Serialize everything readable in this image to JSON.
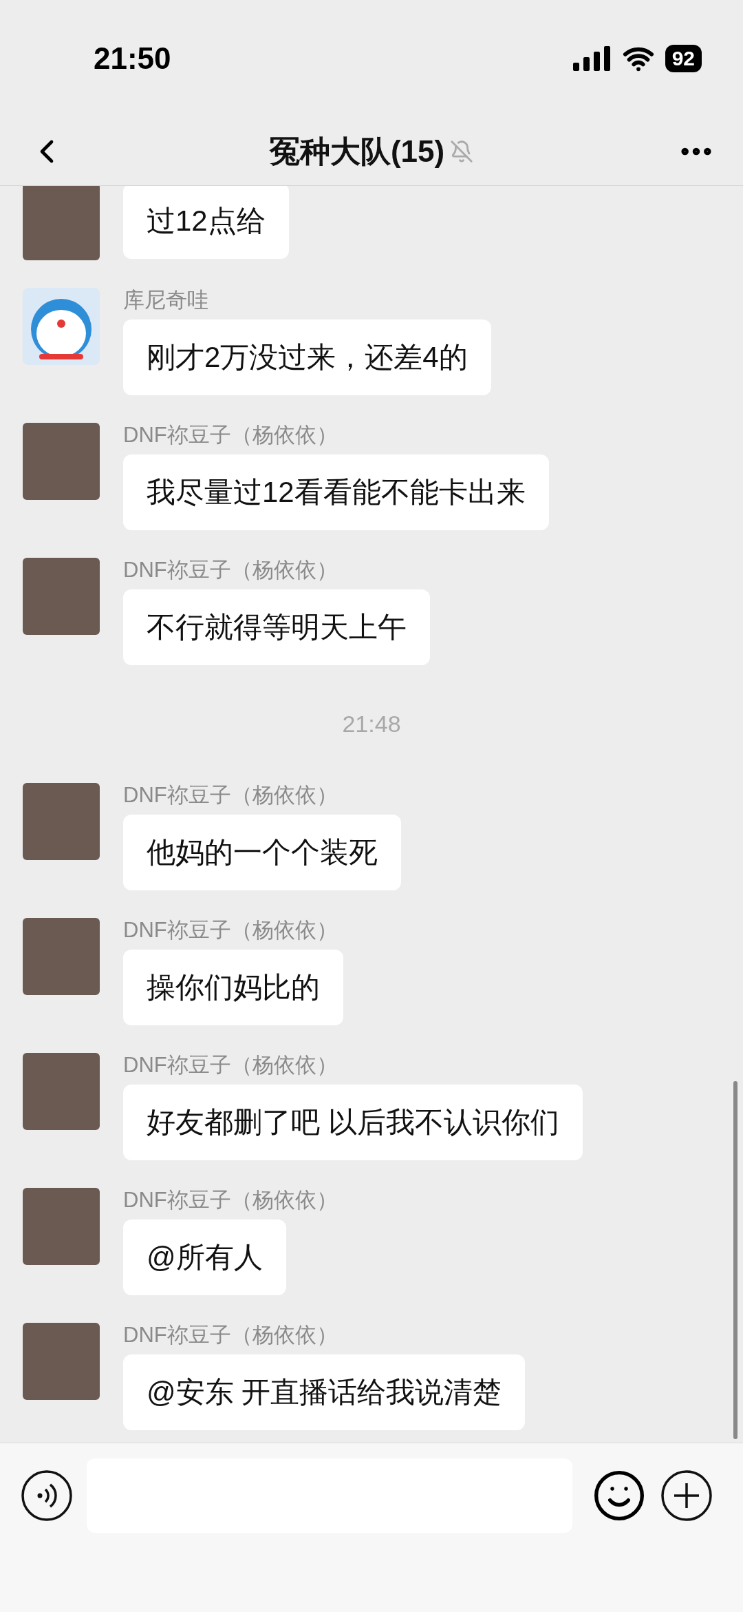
{
  "status_bar": {
    "time": "21:50",
    "battery": "92"
  },
  "header": {
    "title": "冤种大队(15)",
    "muted": true
  },
  "messages": [
    {
      "kind": "message",
      "avatar": {
        "kind": "photo"
      },
      "text": "过12点给"
    },
    {
      "kind": "message",
      "avatar": {
        "kind": "cartoon"
      },
      "sender": "库尼奇哇",
      "text": "刚才2万没过来，还差4的"
    },
    {
      "kind": "message",
      "avatar": {
        "kind": "photo"
      },
      "sender": "DNF祢豆子（杨依依）",
      "text": "我尽量过12看看能不能卡出来"
    },
    {
      "kind": "message",
      "avatar": {
        "kind": "photo"
      },
      "sender": "DNF祢豆子（杨依依）",
      "text": "不行就得等明天上午"
    },
    {
      "kind": "time",
      "text": "21:48"
    },
    {
      "kind": "message",
      "avatar": {
        "kind": "photo"
      },
      "sender": "DNF祢豆子（杨依依）",
      "text": "他妈的一个个装死"
    },
    {
      "kind": "message",
      "avatar": {
        "kind": "photo"
      },
      "sender": "DNF祢豆子（杨依依）",
      "text": "操你们妈比的"
    },
    {
      "kind": "message",
      "avatar": {
        "kind": "photo"
      },
      "sender": "DNF祢豆子（杨依依）",
      "text": "好友都删了吧 以后我不认识你们"
    },
    {
      "kind": "message",
      "avatar": {
        "kind": "photo"
      },
      "sender": "DNF祢豆子（杨依依）",
      "text": "@所有人"
    },
    {
      "kind": "message",
      "avatar": {
        "kind": "photo"
      },
      "sender": "DNF祢豆子（杨依依）",
      "text": "@安东 开直播话给我说清楚"
    }
  ]
}
